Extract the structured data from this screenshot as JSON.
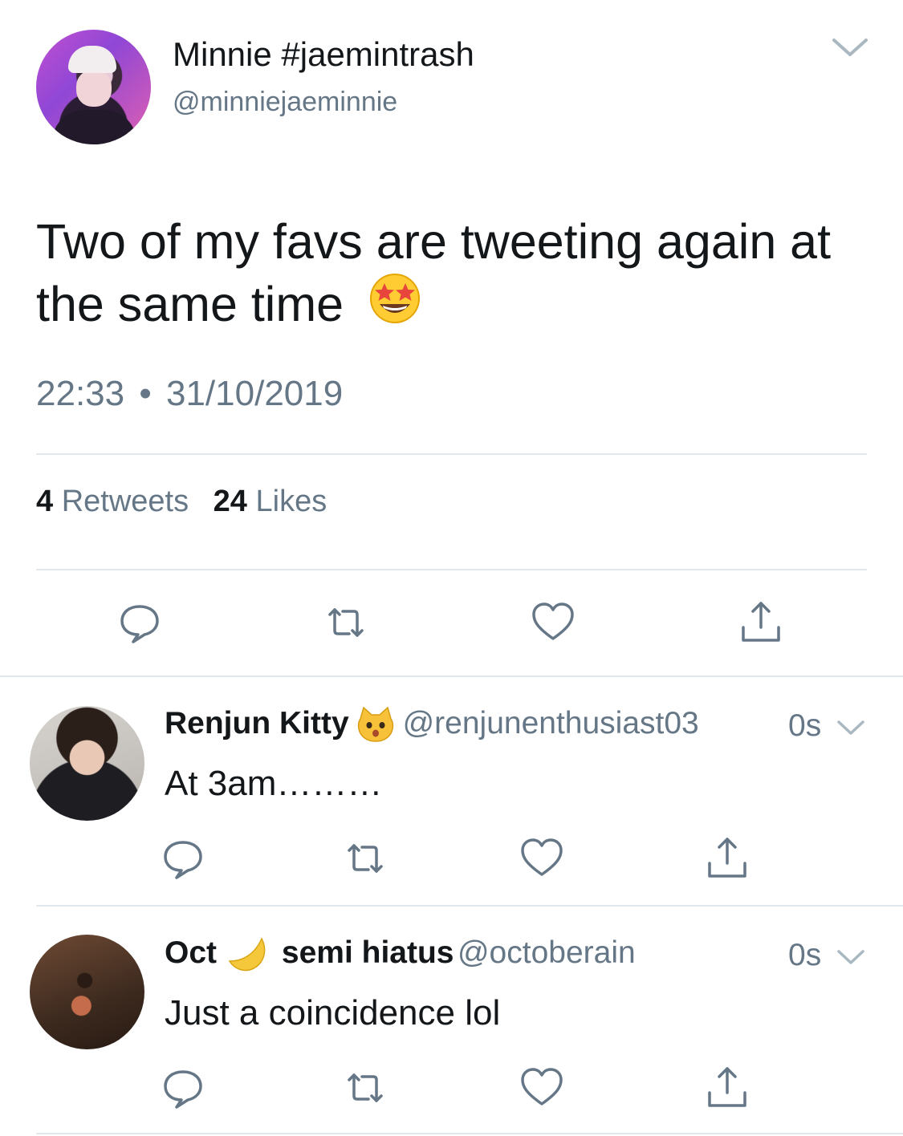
{
  "main_tweet": {
    "author_name": "Minnie #jaemintrash",
    "author_handle": "@minniejaeminnie",
    "text_line1": "Two of my favs are tweeting again at",
    "text_line2": "the same time",
    "text_emoji": "star-struck-emoji",
    "time": "22:33",
    "separator": "•",
    "date": "31/10/2019",
    "retweets_count": "4",
    "retweets_label": "Retweets",
    "likes_count": "24",
    "likes_label": "Likes"
  },
  "replies": [
    {
      "author_name": "Renjun Kitty",
      "name_emoji": "cat-face-emoji",
      "author_handle": "@renjunenthusiast03",
      "time": "0s",
      "text": "At 3am………"
    },
    {
      "author_name_part1": "Oct",
      "name_emoji": "crescent-moon-emoji",
      "author_name_part2": "semi hiatus",
      "author_handle": "@octoberain",
      "time": "0s",
      "text": "Just a coincidence lol"
    }
  ],
  "icons": [
    "reply-icon",
    "retweet-icon",
    "like-icon",
    "share-icon",
    "chevron-down-icon"
  ],
  "colors": {
    "text": "#14171a",
    "secondary": "#657786",
    "icon": "#657786",
    "divider": "#e1e8ed"
  }
}
